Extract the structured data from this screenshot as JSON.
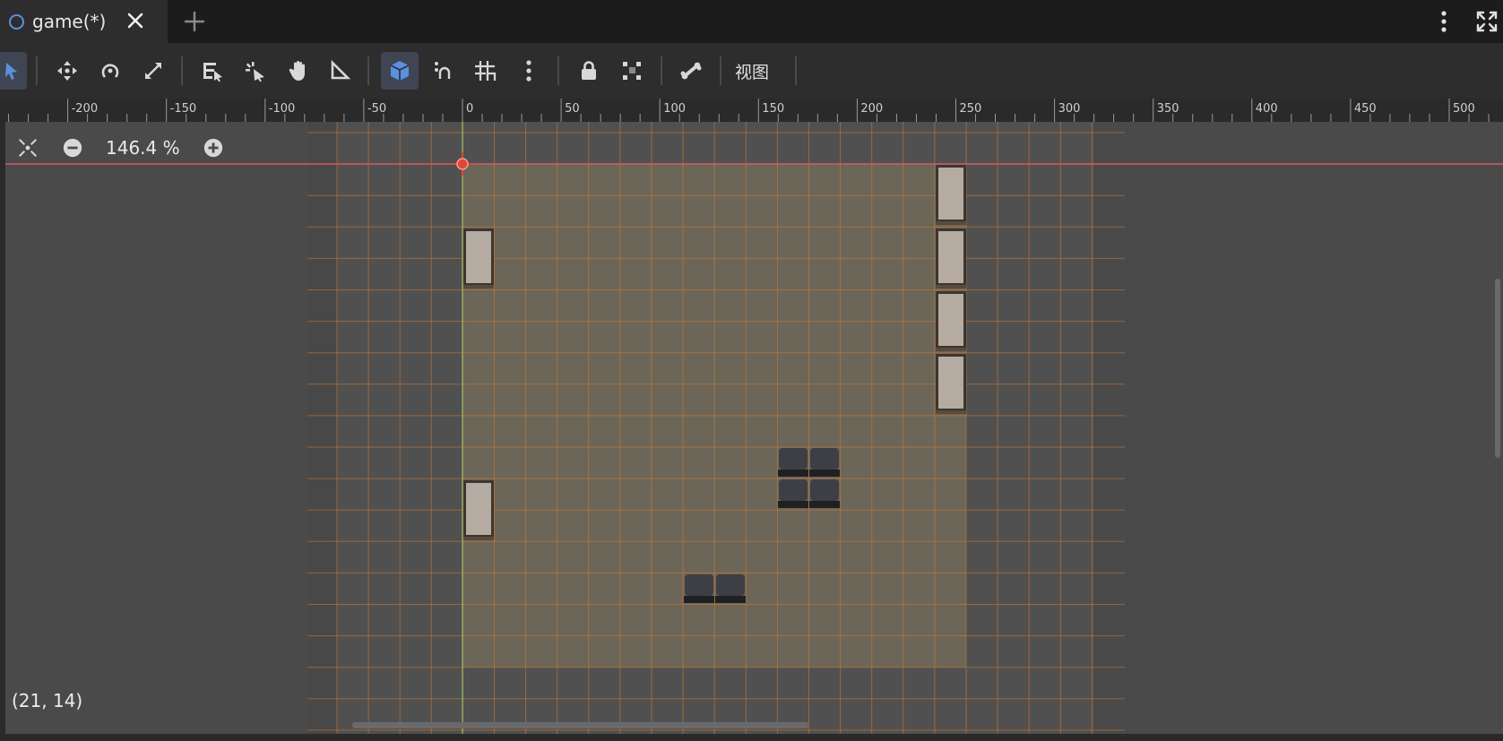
{
  "tab": {
    "title": "game(*)",
    "close_label": "close",
    "add_label": "add"
  },
  "toolbar": {
    "view_label": "视图",
    "tools": [
      "select",
      "move",
      "rotate",
      "scale",
      "list-select",
      "pivot",
      "pan",
      "ruler",
      "snap-3d",
      "smart-snap",
      "grid-snap",
      "more",
      "lock",
      "group",
      "bone"
    ]
  },
  "ruler": {
    "ticks": [
      "-200",
      "-150",
      "-100",
      "-50",
      "0",
      "50",
      "100",
      "150",
      "200",
      "250",
      "300",
      "350",
      "400",
      "450",
      "500"
    ]
  },
  "viewport": {
    "zoom": "146.4 %",
    "cursor_coord": "(21, 14)"
  },
  "colors": {
    "accent": "#5b8fe0",
    "grid_line": "#d97a2e",
    "room_fill": "#6b6658",
    "origin_marker": "#e0473a"
  }
}
